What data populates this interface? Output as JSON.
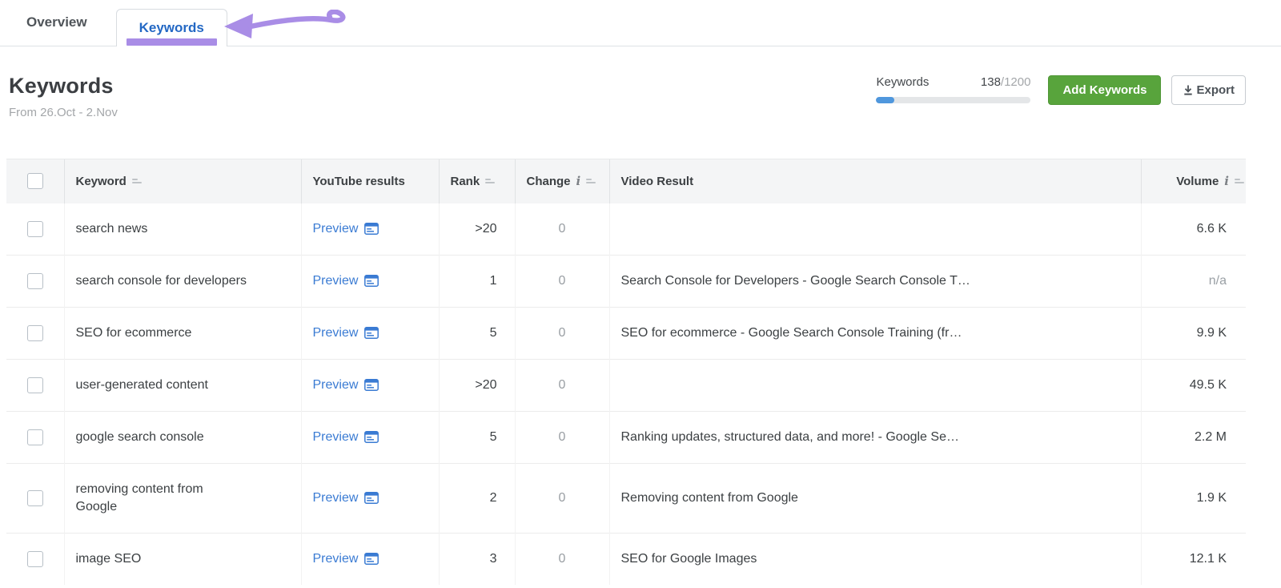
{
  "tabs": [
    {
      "label": "Overview",
      "active": false
    },
    {
      "label": "Keywords",
      "active": true
    }
  ],
  "header": {
    "title": "Keywords",
    "date_range": "From 26.Oct - 2.Nov",
    "quota": {
      "label": "Keywords",
      "used": "138",
      "limit": "/1200",
      "percent": 11.5
    },
    "add_button": "Add Keywords",
    "export_button": "Export"
  },
  "table": {
    "columns": {
      "keyword": "Keyword",
      "youtube_results": "YouTube results",
      "rank": "Rank",
      "change": "Change",
      "video_result": "Video Result",
      "volume": "Volume"
    },
    "preview_label": "Preview",
    "rows": [
      {
        "keyword": "search news",
        "rank": ">20",
        "change": "0",
        "video_result": "",
        "volume": "6.6 K"
      },
      {
        "keyword": "search console for developers",
        "rank": "1",
        "change": "0",
        "video_result": "Search Console for Developers - Google Search Console T…",
        "volume": "n/a"
      },
      {
        "keyword": "SEO for ecommerce",
        "rank": "5",
        "change": "0",
        "video_result": "SEO for ecommerce - Google Search Console Training (fr…",
        "volume": "9.9 K"
      },
      {
        "keyword": "user-generated content",
        "rank": ">20",
        "change": "0",
        "video_result": "",
        "volume": "49.5 K"
      },
      {
        "keyword": "google search console",
        "rank": "5",
        "change": "0",
        "video_result": "Ranking updates, structured data, and more! - Google Se…",
        "volume": "2.2 M"
      },
      {
        "keyword": "removing content from Google",
        "rank": "2",
        "change": "0",
        "video_result": "Removing content from Google",
        "volume": "1.9 K"
      },
      {
        "keyword": "image SEO",
        "rank": "3",
        "change": "0",
        "video_result": "SEO for Google Images",
        "volume": "12.1 K"
      }
    ]
  },
  "colors": {
    "accent_purple": "#a98de6",
    "tab_blue": "#2368c4",
    "link_blue": "#3a7bd3",
    "button_green": "#58a43c",
    "progress_blue": "#4f97dd"
  }
}
